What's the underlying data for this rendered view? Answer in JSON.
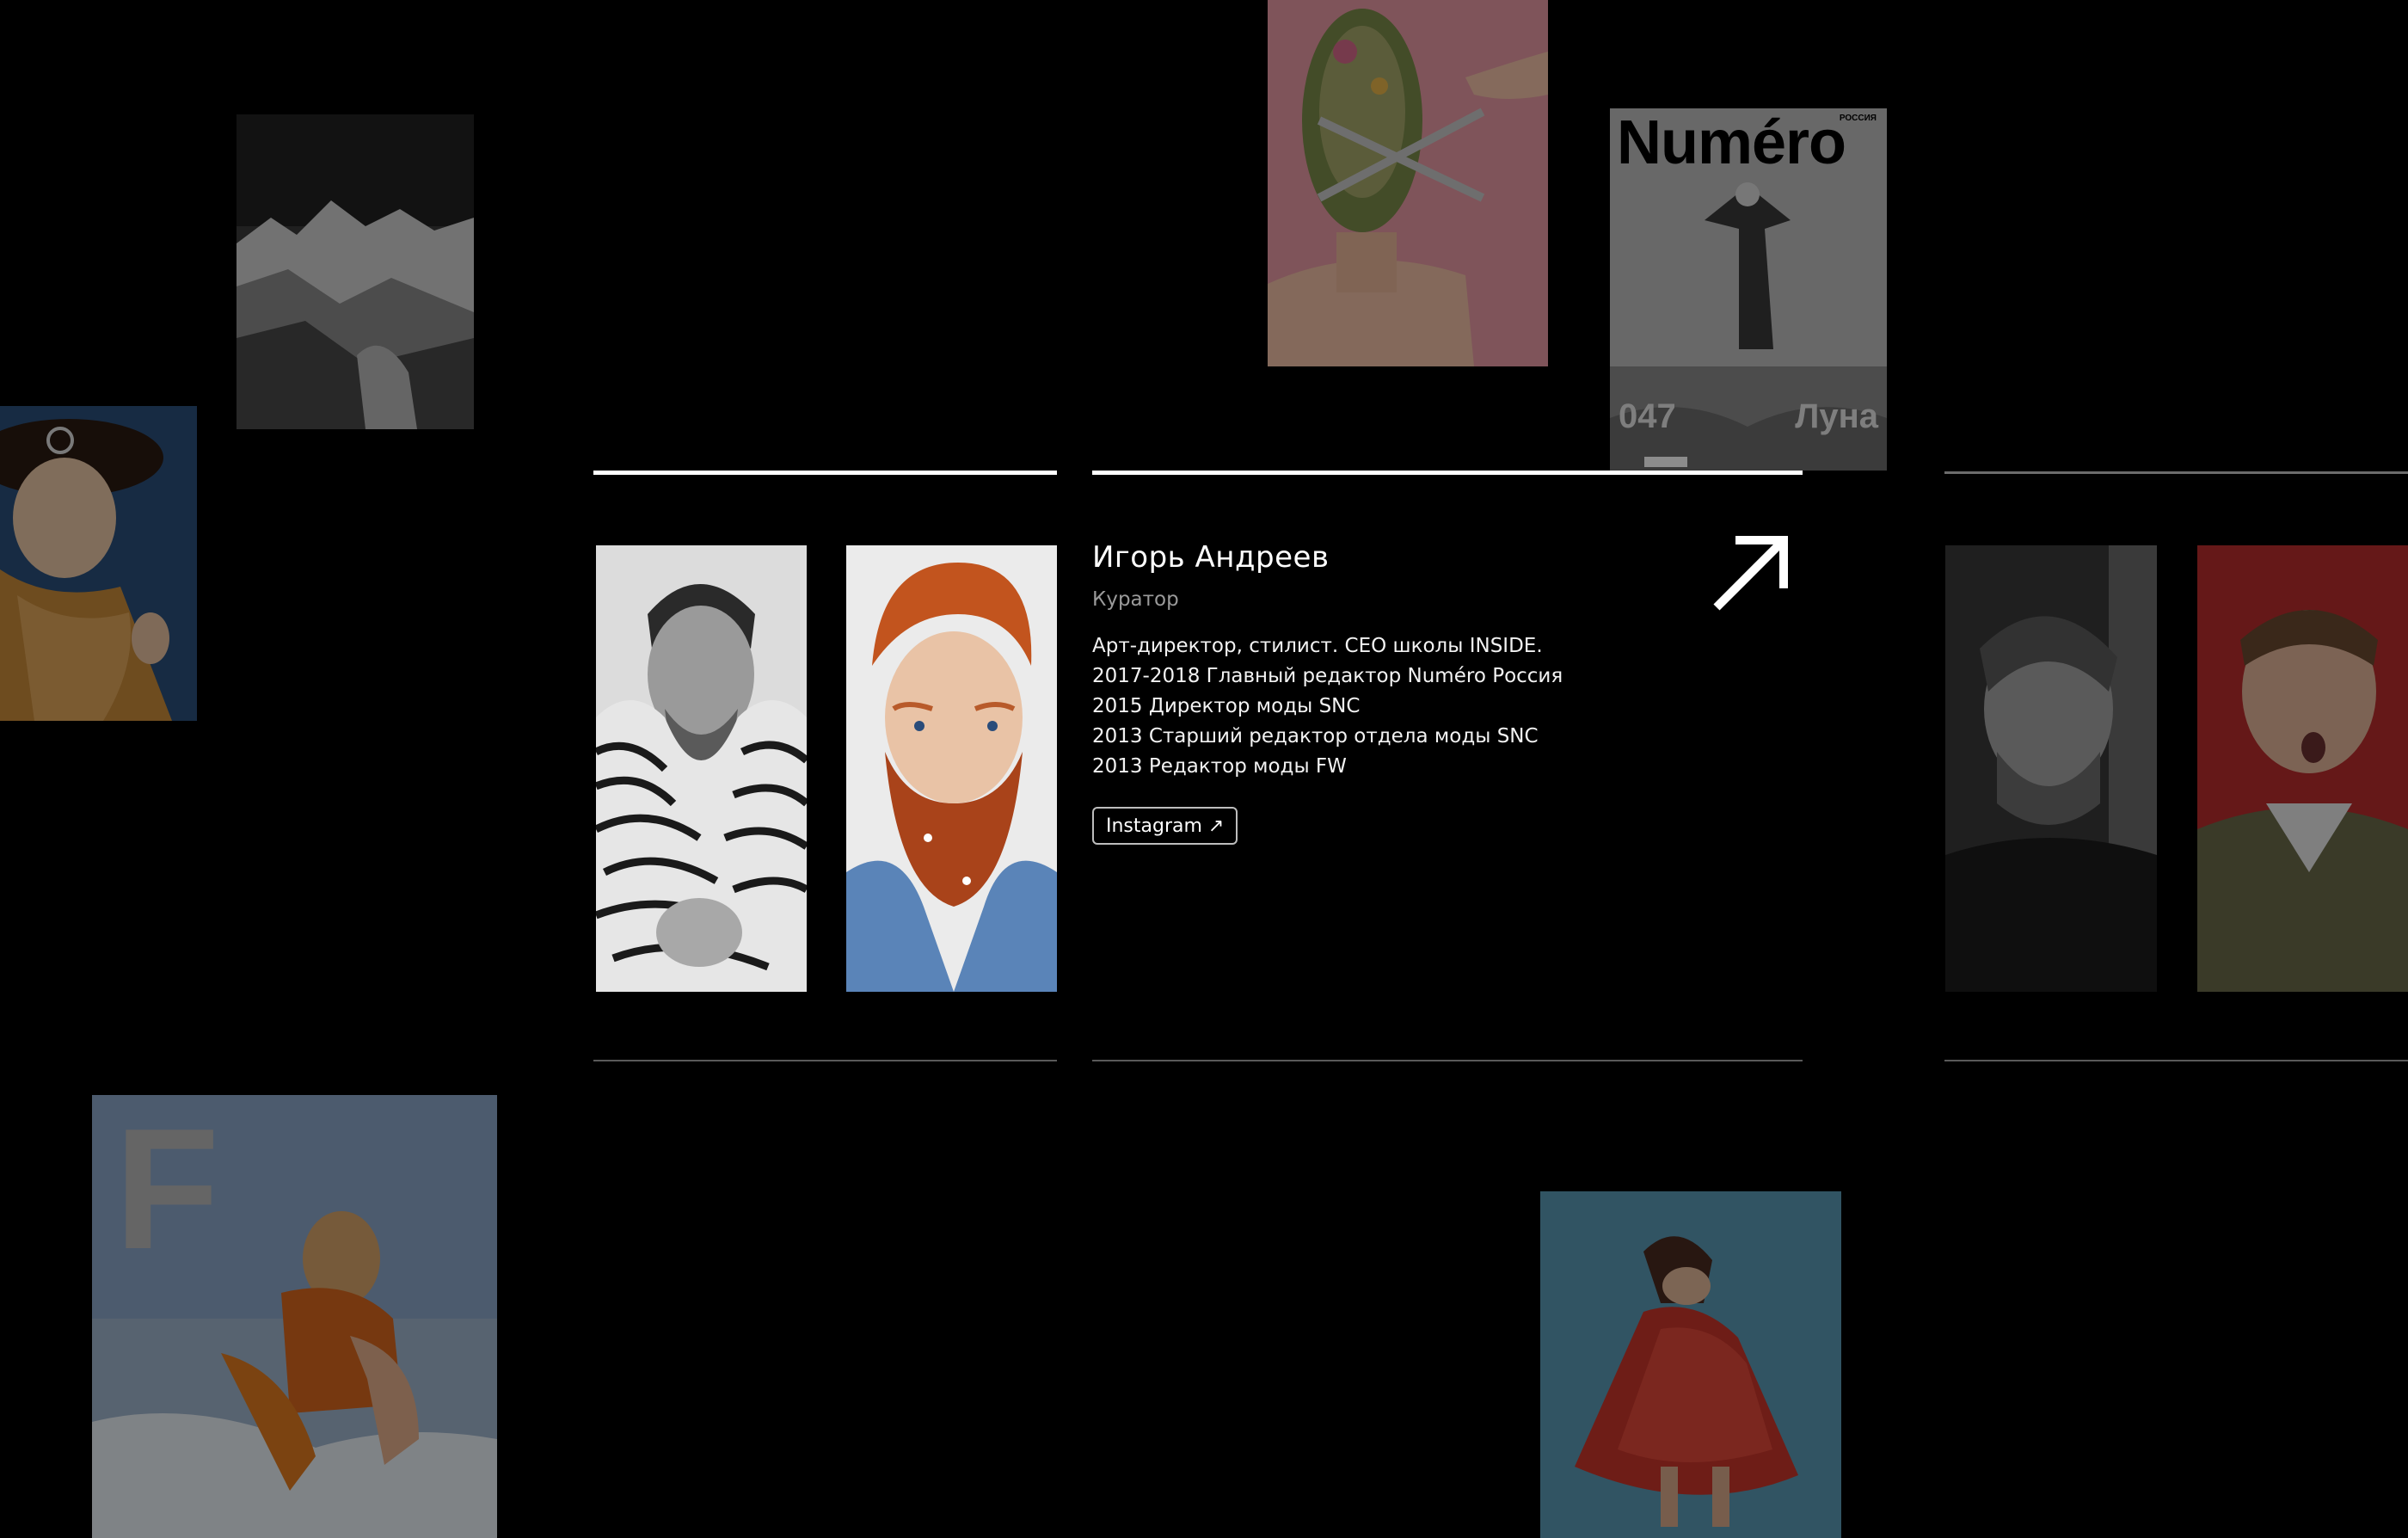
{
  "magazine_cover": {
    "brand": "Numéro",
    "edition": "РОССИЯ",
    "issue_number": "047",
    "issue_title": "Луна"
  },
  "magazine_cover_f": {
    "letter": "F"
  },
  "profile": {
    "name": "Игорь Андреев",
    "role": "Куратор",
    "bio": [
      "Арт-директор, стилист. CEO школы INSIDE.",
      "2017-2018 Главный редактор Numéro Россия",
      "2015 Директор моды SNC",
      "2013 Старший редактор отдела моды SNC",
      "2013 Редактор моды FW"
    ],
    "instagram_label": "Instagram ↗"
  },
  "colors": {
    "background": "#000000",
    "text": "#ffffff",
    "muted_text": "#9a9a9a",
    "active_rule": "#ffffff",
    "inactive_rule": "#5a5a5a"
  },
  "icons": {
    "open_profile": "arrow-up-right-icon"
  }
}
